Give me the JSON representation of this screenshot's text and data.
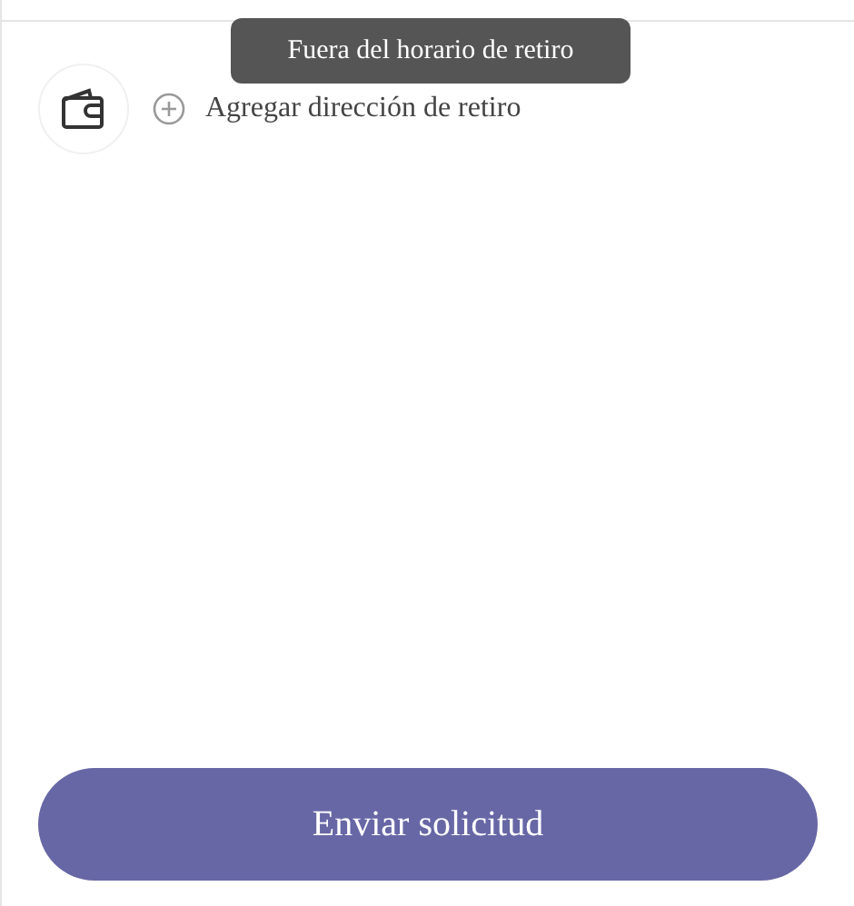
{
  "tooltip": {
    "text": "Fuera del horario de retiro"
  },
  "address_row": {
    "label": "Agregar dirección de retiro"
  },
  "submit_button": {
    "label": "Enviar solicitud"
  }
}
